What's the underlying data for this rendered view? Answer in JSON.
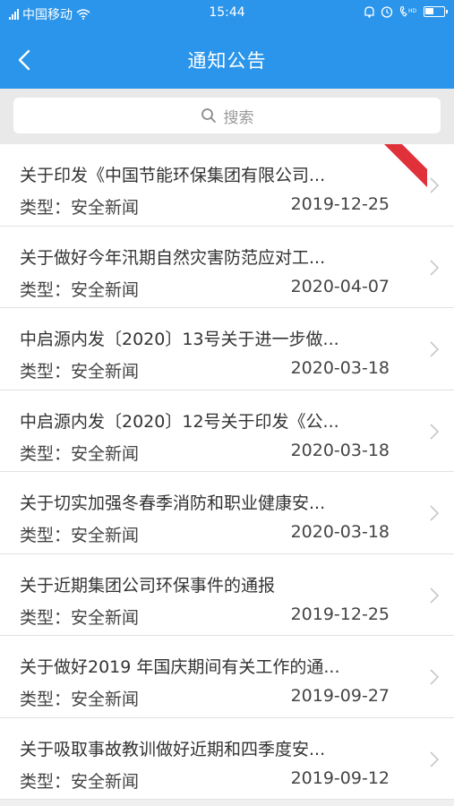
{
  "status": {
    "carrier": "中国移动",
    "time": "15:44"
  },
  "nav": {
    "title": "通知公告"
  },
  "search": {
    "placeholder": "搜索"
  },
  "colors": {
    "accent": "#2a95ea",
    "badge": "#e0303a"
  },
  "items": [
    {
      "title": "关于印发《中国节能环保集团有限公司...",
      "type": "类型：安全新闻",
      "date": "2019-12-25",
      "badge": "TOP"
    },
    {
      "title": "关于做好今年汛期自然灾害防范应对工...",
      "type": "类型：安全新闻",
      "date": "2020-04-07"
    },
    {
      "title": "中启源内发〔2020〕13号关于进一步做...",
      "type": "类型：安全新闻",
      "date": "2020-03-18"
    },
    {
      "title": "中启源内发〔2020〕12号关于印发《公...",
      "type": "类型：安全新闻",
      "date": "2020-03-18"
    },
    {
      "title": "关于切实加强冬春季消防和职业健康安...",
      "type": "类型：安全新闻",
      "date": "2020-03-18"
    },
    {
      "title": "关于近期集团公司环保事件的通报",
      "type": "类型：安全新闻",
      "date": "2019-12-25"
    },
    {
      "title": "关于做好2019 年国庆期间有关工作的通...",
      "type": "类型：安全新闻",
      "date": "2019-09-27"
    },
    {
      "title": "关于吸取事故教训做好近期和四季度安...",
      "type": "类型：安全新闻",
      "date": "2019-09-12"
    }
  ]
}
